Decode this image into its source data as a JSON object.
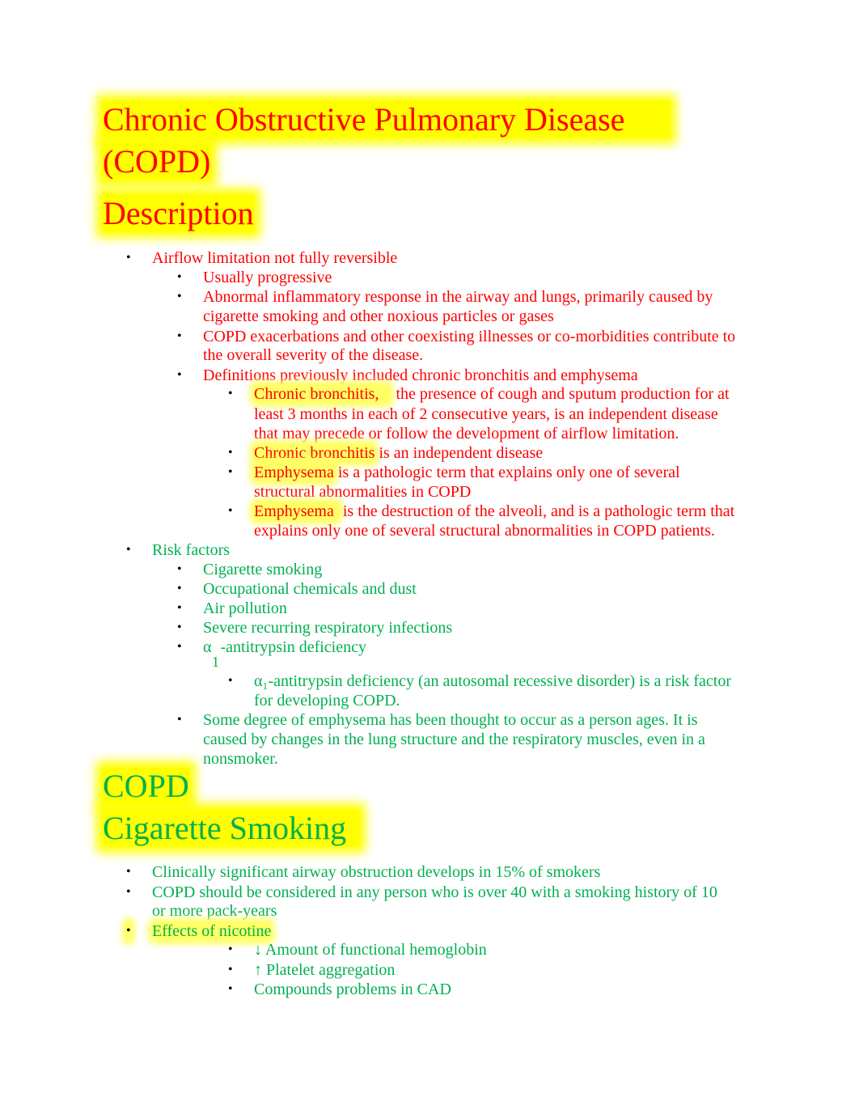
{
  "colors": {
    "red": "#ff0000",
    "green": "#00b050",
    "highlight": "#ffff00"
  },
  "title": {
    "line1": "Chronic Obstructive Pulmonary Disease",
    "line2": "(COPD)"
  },
  "description": {
    "heading": "Description",
    "item1": "Airflow limitation not fully reversible",
    "sub": [
      "Usually progressive",
      "Abnormal inflammatory response in the airway and lungs, primarily caused by",
      "cigarette smoking and other noxious particles or gases",
      "COPD exacerbations and other coexisting illnesses or co-morbidities contribute to",
      "the overall severity of the disease.",
      "Definitions previously included chronic bronchitis and emphysema"
    ],
    "defs": {
      "cb1_term": "Chronic bronchitis,",
      "cb1_rest": "the presence of cough and sputum production for at",
      "cb1_l2": "least 3 months in each of 2 consecutive years, is an independent disease",
      "cb1_l3": "that may precede or follow the development of airflow limitation.",
      "cb2_term": "Chronic bronchitis",
      "cb2_rest": " is an independent disease",
      "em1_term": "Emphysema",
      "em1_rest": " is a pathologic term that explains only one of several",
      "em1_l2": "structural abnormalities in COPD",
      "em2_term": "Emphysema",
      "em2_rest": "is the destruction of the alveoli, and is a pathologic term that",
      "em2_l2": "explains only one of several structural abnormalities in COPD patients."
    }
  },
  "risk": {
    "label": "Risk factors",
    "items": [
      "Cigarette smoking",
      "Occupational chemicals and dust",
      "Air pollution",
      "Severe recurring respiratory infections"
    ],
    "alpha_symbol": "α",
    "alpha_sub": "1",
    "alpha_rest": "-antitrypsin deficiency",
    "alpha_detail_l1": "α₁-antitrypsin deficiency (an autosomal recessive disorder) is a risk factor",
    "alpha_detail_l2": "for developing COPD.",
    "aging_l1": "Some degree of emphysema has been thought to occur as a person ages. It is",
    "aging_l2": "caused by changes in the lung structure and the respiratory muscles, even in a",
    "aging_l3": "nonsmoker."
  },
  "smoking": {
    "heading1": "COPD",
    "heading2": "Cigarette Smoking",
    "items": [
      "Clinically significant airway obstruction develops in 15% of smokers",
      "COPD should be considered in any person who is over 40 with a smoking history of 10",
      "or more pack-years",
      "Effects of nicotine"
    ],
    "nicotine": [
      "↓ Amount of functional hemoglobin",
      "↑ Platelet aggregation",
      "Compounds problems in CAD"
    ]
  },
  "bullet_glyph": "•"
}
